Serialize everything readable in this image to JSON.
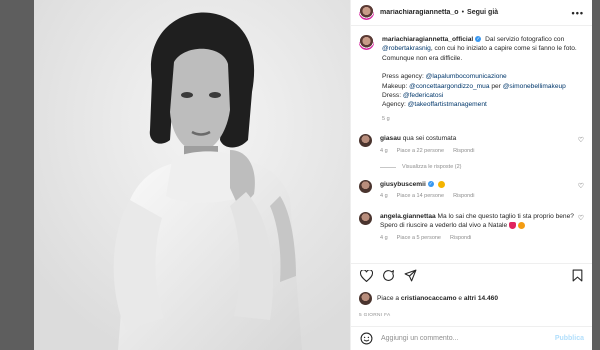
{
  "post": {
    "username": "mariachiaragiannetta_o",
    "follow_dot": "•",
    "follow_label": "Segui già",
    "more": "•••"
  },
  "caption": {
    "username": "mariachiaragiannetta_official",
    "line1": "Dal servizio fotografico con",
    "mention1": "@robertakrasnig",
    "line2": ", con cui ho iniziato a capire come si fanno le foto. Comunque non era difficile.",
    "press_label": "Press agency: ",
    "press_handle": "@lapalumbocomunicazione",
    "makeup_label": "Makeup: ",
    "makeup_handle1": "@concettaargondizzo_mua",
    "makeup_per": " per ",
    "makeup_handle2": "@simonebellimakeup",
    "dress_label": "Dress: ",
    "dress_handle": "@federicatosi",
    "agency_label": "Agency: ",
    "agency_handle": "@takeoffartistmanagement",
    "time": "5 g"
  },
  "comments": [
    {
      "username": "giasau",
      "text": "qua sei costumata",
      "time": "4 g",
      "likes": "Piace a 22 persone",
      "reply": "Rispondi",
      "view_replies": "Visualizza le risposte (2)"
    },
    {
      "username": "giusybuscemii",
      "text": "",
      "time": "4 g",
      "likes": "Piace a 14 persone",
      "reply": "Rispondi"
    },
    {
      "username": "angela.giannettaa",
      "text": "Ma lo sai che questo taglio ti sta proprio bene? Spero di riuscire a vederlo dal vivo a Natale",
      "time": "4 g",
      "likes": "Piace a 5 persone",
      "reply": "Rispondi"
    }
  ],
  "likes": {
    "prefix": "Piace a ",
    "user": "cristianocaccamo",
    "middle": " e ",
    "others": "altri 14.460"
  },
  "date": "5 GIORNI FA",
  "add_comment": {
    "placeholder": "Aggiungi un commento...",
    "publish": "Pubblica"
  },
  "icons": {
    "like": "heart-icon",
    "comment": "comment-icon",
    "share": "share-icon",
    "save": "bookmark-icon",
    "emoji": "smiley-icon",
    "more": "more-icon",
    "verified": "verified-badge-icon"
  },
  "colors": {
    "link": "#00376b",
    "muted": "#8e8e8e",
    "verified": "#3897f0",
    "publish_disabled": "#b2dffc"
  }
}
